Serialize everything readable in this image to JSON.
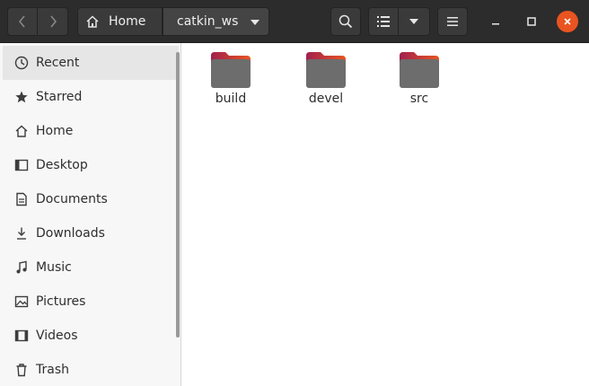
{
  "header": {
    "path_home_label": "Home",
    "path_current_label": "catkin_ws"
  },
  "sidebar": {
    "items": [
      {
        "label": "Recent",
        "icon": "clock-icon",
        "active": true
      },
      {
        "label": "Starred",
        "icon": "star-icon"
      },
      {
        "label": "Home",
        "icon": "home-icon"
      },
      {
        "label": "Desktop",
        "icon": "desktop-icon"
      },
      {
        "label": "Documents",
        "icon": "document-icon"
      },
      {
        "label": "Downloads",
        "icon": "download-icon"
      },
      {
        "label": "Music",
        "icon": "music-note-icon"
      },
      {
        "label": "Pictures",
        "icon": "picture-icon"
      },
      {
        "label": "Videos",
        "icon": "video-icon"
      },
      {
        "label": "Trash",
        "icon": "trash-icon"
      }
    ]
  },
  "main": {
    "folders": [
      {
        "name": "build"
      },
      {
        "name": "devel"
      },
      {
        "name": "src"
      }
    ]
  },
  "colors": {
    "header_bg": "#2c2c2c",
    "close_button": "#e95420",
    "folder_body": "#6d6d6d",
    "folder_tab_gradient_start": "#a0214f",
    "folder_tab_gradient_end": "#e95420"
  }
}
